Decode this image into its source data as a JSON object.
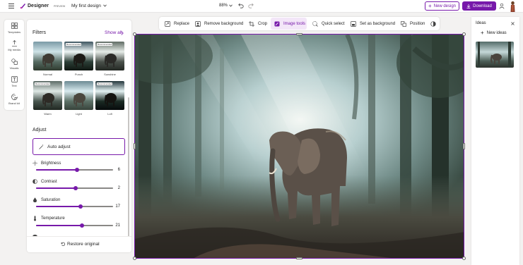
{
  "app": {
    "name": "Designer",
    "preview_badge": "PREVIEW",
    "document_title": "My first design",
    "zoom": "88%"
  },
  "header": {
    "new_design_label": "New design",
    "download_label": "Download"
  },
  "left_rail": {
    "items": [
      {
        "label": "Templates",
        "icon": "templates-icon"
      },
      {
        "label": "My media",
        "icon": "my-media-icon"
      },
      {
        "label": "Visuals",
        "icon": "visuals-icon"
      },
      {
        "label": "Text",
        "icon": "text-icon"
      },
      {
        "label": "Brand kit",
        "icon": "brand-kit-icon"
      }
    ]
  },
  "filters": {
    "title": "Filters",
    "show_all": "Show all",
    "items": [
      {
        "label": "Normal",
        "badge": ""
      },
      {
        "label": "Punch",
        "badge": "Recommended"
      },
      {
        "label": "Sunshine",
        "badge": "Recommended"
      },
      {
        "label": "Warm",
        "badge": "Recommended"
      },
      {
        "label": "Light",
        "badge": ""
      },
      {
        "label": "Lofi",
        "badge": "Recommended"
      }
    ]
  },
  "adjust": {
    "title": "Adjust",
    "auto_adjust": "Auto adjust",
    "sliders": [
      {
        "label": "Brightness",
        "value": "6",
        "fraction": 0.53
      },
      {
        "label": "Contrast",
        "value": "2",
        "fraction": 0.51
      },
      {
        "label": "Saturation",
        "value": "17",
        "fraction": 0.58
      },
      {
        "label": "Temperature",
        "value": "21",
        "fraction": 0.6
      }
    ],
    "restore_label": "Restore original"
  },
  "toolbar": {
    "items": [
      {
        "label": "Replace",
        "icon": "replace-icon"
      },
      {
        "label": "Remove background",
        "icon": "remove-background-icon"
      },
      {
        "label": "Crop",
        "icon": "crop-icon"
      },
      {
        "label": "Image tools",
        "icon": "image-tools-icon",
        "active": true
      },
      {
        "label": "Quick select",
        "icon": "quick-select-icon"
      },
      {
        "label": "Set as background",
        "icon": "set-as-background-icon"
      },
      {
        "label": "Position",
        "icon": "position-icon"
      },
      {
        "label": "",
        "icon": "filter-circle-icon"
      }
    ]
  },
  "ideas": {
    "title": "Ideas",
    "new_ideas_label": "New ideas"
  },
  "colors": {
    "accent": "#7719aa",
    "accent_light": "#f3e6f8"
  }
}
